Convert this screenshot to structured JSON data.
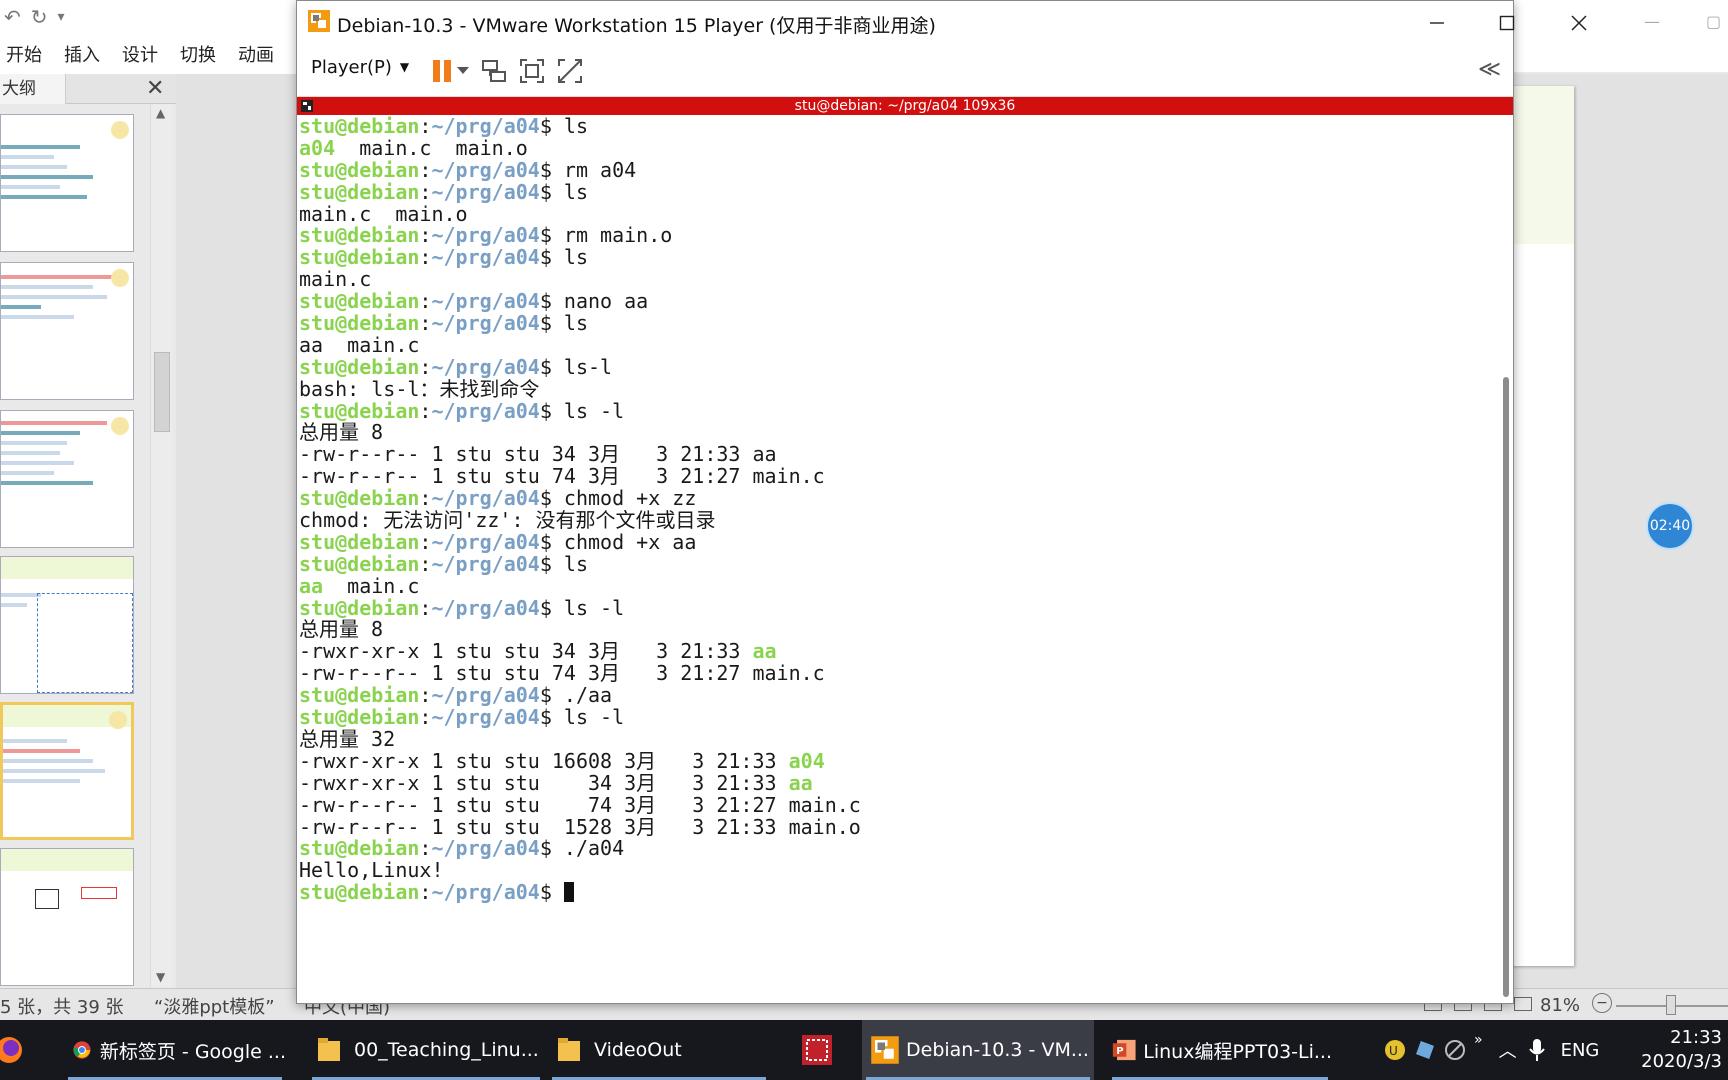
{
  "ppt": {
    "menu": [
      "开始",
      "插入",
      "设计",
      "切换",
      "动画"
    ],
    "outline_tab": "大纲",
    "status": {
      "slide_info": "5 张，共 39 张",
      "theme": "“淡雅ppt模板”",
      "language": "中文(中国)",
      "zoom": "81%"
    },
    "timer": "02:40"
  },
  "vm": {
    "title": "Debian-10.3 - VMware Workstation 15 Player (仅用于非商业用途)",
    "player_menu": "Player(P)",
    "terminal_title": "stu@debian: ~/prg/a04 109x36"
  },
  "terminal": {
    "user": "stu@debian",
    "path": "~/prg/a04",
    "lines": [
      {
        "t": "cmd",
        "cmd": " ls"
      },
      {
        "t": "out",
        "parts": [
          {
            "s": "a04",
            "c": "g"
          },
          {
            "s": "  main.c  main.o",
            "c": ""
          }
        ]
      },
      {
        "t": "cmd",
        "cmd": " rm a04"
      },
      {
        "t": "cmd",
        "cmd": " ls"
      },
      {
        "t": "out",
        "parts": [
          {
            "s": "main.c  main.o",
            "c": ""
          }
        ]
      },
      {
        "t": "cmd",
        "cmd": " rm main.o"
      },
      {
        "t": "cmd",
        "cmd": " ls"
      },
      {
        "t": "out",
        "parts": [
          {
            "s": "main.c",
            "c": ""
          }
        ]
      },
      {
        "t": "cmd",
        "cmd": " nano aa"
      },
      {
        "t": "cmd",
        "cmd": " ls"
      },
      {
        "t": "out",
        "parts": [
          {
            "s": "aa  main.c",
            "c": ""
          }
        ]
      },
      {
        "t": "cmd",
        "cmd": " ls-l"
      },
      {
        "t": "out",
        "parts": [
          {
            "s": "bash: ls-l：未找到命令",
            "c": ""
          }
        ]
      },
      {
        "t": "cmd",
        "cmd": " ls -l"
      },
      {
        "t": "out",
        "parts": [
          {
            "s": "总用量 8",
            "c": ""
          }
        ]
      },
      {
        "t": "out",
        "parts": [
          {
            "s": "-rw-r--r-- 1 stu stu 34 3月   3 21:33 aa",
            "c": ""
          }
        ]
      },
      {
        "t": "out",
        "parts": [
          {
            "s": "-rw-r--r-- 1 stu stu 74 3月   3 21:27 main.c",
            "c": ""
          }
        ]
      },
      {
        "t": "cmd",
        "cmd": " chmod +x zz"
      },
      {
        "t": "out",
        "parts": [
          {
            "s": "chmod: 无法访问'zz': 没有那个文件或目录",
            "c": ""
          }
        ]
      },
      {
        "t": "cmd",
        "cmd": " chmod +x aa"
      },
      {
        "t": "cmd",
        "cmd": " ls"
      },
      {
        "t": "out",
        "parts": [
          {
            "s": "aa",
            "c": "g"
          },
          {
            "s": "  main.c",
            "c": ""
          }
        ]
      },
      {
        "t": "cmd",
        "cmd": " ls -l"
      },
      {
        "t": "out",
        "parts": [
          {
            "s": "总用量 8",
            "c": ""
          }
        ]
      },
      {
        "t": "out",
        "parts": [
          {
            "s": "-rwxr-xr-x 1 stu stu 34 3月   3 21:33 ",
            "c": ""
          },
          {
            "s": "aa",
            "c": "g"
          }
        ]
      },
      {
        "t": "out",
        "parts": [
          {
            "s": "-rw-r--r-- 1 stu stu 74 3月   3 21:27 main.c",
            "c": ""
          }
        ]
      },
      {
        "t": "cmd",
        "cmd": " ./aa"
      },
      {
        "t": "cmd",
        "cmd": " ls -l"
      },
      {
        "t": "out",
        "parts": [
          {
            "s": "总用量 32",
            "c": ""
          }
        ]
      },
      {
        "t": "out",
        "parts": [
          {
            "s": "-rwxr-xr-x 1 stu stu 16608 3月   3 21:33 ",
            "c": ""
          },
          {
            "s": "a04",
            "c": "g"
          }
        ]
      },
      {
        "t": "out",
        "parts": [
          {
            "s": "-rwxr-xr-x 1 stu stu    34 3月   3 21:33 ",
            "c": ""
          },
          {
            "s": "aa",
            "c": "g"
          }
        ]
      },
      {
        "t": "out",
        "parts": [
          {
            "s": "-rw-r--r-- 1 stu stu    74 3月   3 21:27 main.c",
            "c": ""
          }
        ]
      },
      {
        "t": "out",
        "parts": [
          {
            "s": "-rw-r--r-- 1 stu stu  1528 3月   3 21:33 main.o",
            "c": ""
          }
        ]
      },
      {
        "t": "cmd",
        "cmd": " ./a04"
      },
      {
        "t": "out",
        "parts": [
          {
            "s": "Hello,Linux!",
            "c": ""
          }
        ]
      },
      {
        "t": "prompt",
        "cmd": " "
      }
    ]
  },
  "taskbar": {
    "items": [
      {
        "label": "新标签页 - Google ...",
        "icon": "chrome-icon"
      },
      {
        "label": "00_Teaching_Linu...",
        "icon": "folder-icon"
      },
      {
        "label": "VideoOut",
        "icon": "folder-icon"
      },
      {
        "label": "Debian-10.3 - VM...",
        "icon": "vmware-icon"
      },
      {
        "label": "Linux编程PPT03-Li...",
        "icon": "powerpoint-icon"
      }
    ],
    "lang": "ENG",
    "time": "21:33",
    "date": "2020/3/3"
  },
  "colors": {
    "term_user": "#8ad34e",
    "term_path": "#7a9fc4",
    "term_titlebar": "#d10f0f",
    "taskbar": "#16181d"
  }
}
